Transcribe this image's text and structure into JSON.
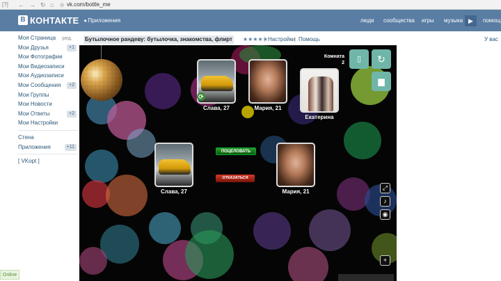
{
  "browser": {
    "bookmark_mark": "[?]",
    "url": "vk.com/bottle_me"
  },
  "header": {
    "logo_letter": "В",
    "logo_text": "КОНТАКТЕ",
    "apps_link": "Приложения",
    "nav": [
      "люди",
      "сообщества",
      "игры",
      "музыка",
      "помощ"
    ],
    "next_icon": "▶"
  },
  "sidebar": {
    "items": [
      {
        "label": "Моя Страница",
        "badge": "",
        "edit": "ред."
      },
      {
        "label": "Мои Друзья",
        "badge": "+1"
      },
      {
        "label": "Мои Фотографии",
        "badge": ""
      },
      {
        "label": "Мои Видеозаписи",
        "badge": ""
      },
      {
        "label": "Мои Аудиозаписи",
        "badge": ""
      },
      {
        "label": "Мои Сообщения",
        "badge": "+2"
      },
      {
        "label": "Мои Группы",
        "badge": ""
      },
      {
        "label": "Мои Новости",
        "badge": ""
      },
      {
        "label": "Мои Ответы",
        "badge": "+2"
      },
      {
        "label": "Мои Настройки",
        "badge": ""
      }
    ],
    "wall": "Стена",
    "apps": "Приложения",
    "apps_badge": "+11",
    "vkopt": "[ VKopt ]",
    "online": "Online"
  },
  "app": {
    "title": "Бутылочное рандеву: бутылочка, знакомства, флирт",
    "stars": "★★★★★",
    "settings": "Настройки",
    "help": "Помощь",
    "right_link": "У вас"
  },
  "game": {
    "room_label": "Комната",
    "room_number": "2",
    "players": [
      {
        "name": "Слава, 27",
        "avatar": "car"
      },
      {
        "name": "Мария, 21",
        "avatar": "woman"
      },
      {
        "name": "Екатерина",
        "avatar": "group"
      },
      {
        "name": "Слава, 27",
        "avatar": "car"
      },
      {
        "name": "Мария, 21",
        "avatar": "woman"
      }
    ],
    "kiss_button": "ПОЦЕЛОВАТЬ",
    "refuse_button": "ОТКАЗАТЬСЯ",
    "accent_color": "#6fb6a8"
  }
}
